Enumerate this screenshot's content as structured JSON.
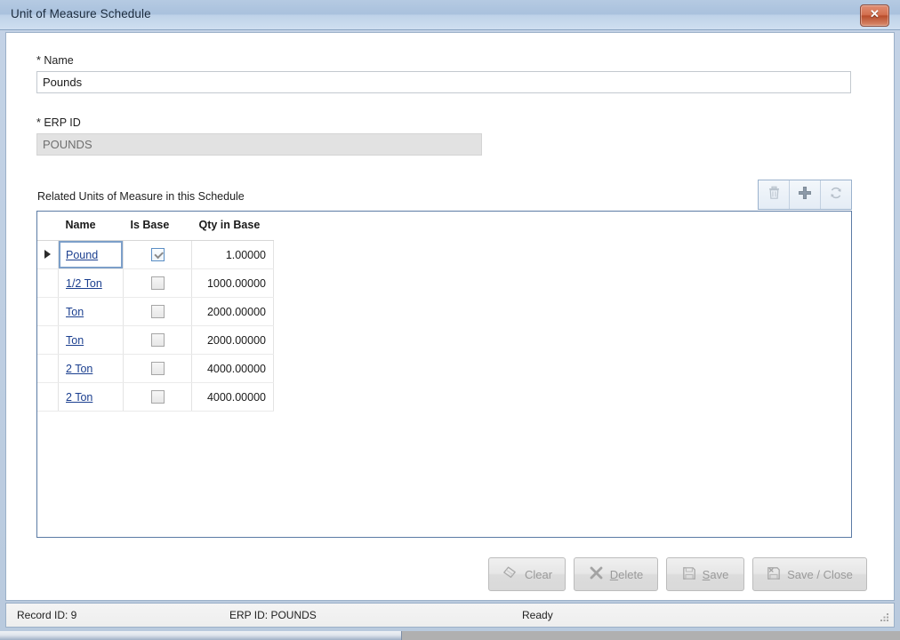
{
  "window": {
    "title": "Unit of Measure Schedule",
    "close_glyph": "✕",
    "close_icon_name": "close-icon"
  },
  "form": {
    "name_label": "* Name",
    "name_value": "Pounds",
    "name_placeholder": "",
    "erp_label": "* ERP ID",
    "erp_value": "POUNDS",
    "erp_placeholder": ""
  },
  "grid_section": {
    "caption": "Related Units of Measure in this Schedule",
    "toolbar": [
      {
        "name": "delete-row-icon",
        "title": "Delete",
        "enabled": false
      },
      {
        "name": "add-row-icon",
        "title": "Add",
        "enabled": true
      },
      {
        "name": "refresh-icon",
        "title": "Refresh",
        "enabled": false
      }
    ],
    "columns": [
      "Name",
      "Is Base",
      "Qty in Base"
    ],
    "rows": [
      {
        "name": "Pound",
        "is_base": true,
        "qty": "1.00000",
        "selected": true
      },
      {
        "name": "1/2 Ton",
        "is_base": false,
        "qty": "1000.00000",
        "selected": false
      },
      {
        "name": "Ton",
        "is_base": false,
        "qty": "2000.00000",
        "selected": false
      },
      {
        "name": "Ton",
        "is_base": false,
        "qty": "2000.00000",
        "selected": false
      },
      {
        "name": "2 Ton",
        "is_base": false,
        "qty": "4000.00000",
        "selected": false
      },
      {
        "name": "2 Ton",
        "is_base": false,
        "qty": "4000.00000",
        "selected": false
      }
    ]
  },
  "actions": [
    {
      "id": "clear",
      "label_pre": "",
      "label_key": "",
      "label_post": "Clear",
      "icon": "eraser-icon",
      "enabled": false
    },
    {
      "id": "delete",
      "label_pre": "",
      "label_key": "D",
      "label_post": "elete",
      "icon": "x-mark-icon",
      "enabled": false
    },
    {
      "id": "save",
      "label_pre": "",
      "label_key": "S",
      "label_post": "ave",
      "icon": "floppy-disk-icon",
      "enabled": false
    },
    {
      "id": "save-close",
      "label_pre": "",
      "label_key": "",
      "label_post": "Save / Close",
      "icon": "floppy-disk-close-icon",
      "enabled": false
    }
  ],
  "status": {
    "record_id": "Record ID: 9",
    "erp_id": "ERP ID: POUNDS",
    "state": "Ready",
    "grip_icon": "resize-grip-icon"
  },
  "colors": {
    "titlebar": "#a9c1dd",
    "close_button": "#c9603f",
    "grid_border": "#5b7ba5",
    "link": "#1b3f8f",
    "selected_row": "#eef4fb",
    "disabled_field": "#e2e2e2"
  }
}
